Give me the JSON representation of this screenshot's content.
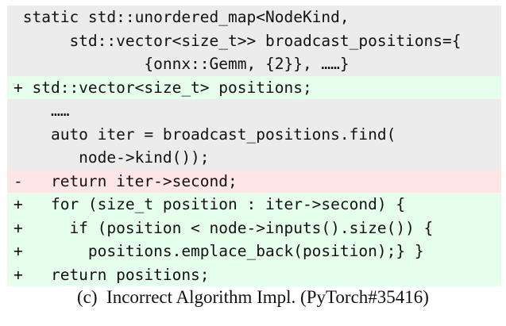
{
  "diff_lines": [
    {
      "type": "ctx",
      "text": " static std::unordered_map<NodeKind,"
    },
    {
      "type": "ctx",
      "text": "      std::vector<size_t>> broadcast_positions={"
    },
    {
      "type": "ctx",
      "text": "              {onnx::Gemm, {2}}, ……}"
    },
    {
      "type": "add",
      "text": "+ std::vector<size_t> positions;"
    },
    {
      "type": "ctx",
      "text": "    ……"
    },
    {
      "type": "ctx",
      "text": "    auto iter = broadcast_positions.find("
    },
    {
      "type": "ctx",
      "text": "       node->kind());"
    },
    {
      "type": "del",
      "text": "-   return iter->second;"
    },
    {
      "type": "add",
      "text": "+   for (size_t position : iter->second) {"
    },
    {
      "type": "add",
      "text": "+     if (position < node->inputs().size()) {"
    },
    {
      "type": "add",
      "text": "+       positions.emplace_back(position);} }"
    },
    {
      "type": "add",
      "text": "+   return positions;"
    }
  ],
  "caption": "(c)  Incorrect Algorithm Impl. (PyTorch#35416)",
  "colors": {
    "context_bg": "#ececec",
    "added_bg": "#e6ffec",
    "removed_bg": "#ffe6e6",
    "text": "#111111"
  }
}
